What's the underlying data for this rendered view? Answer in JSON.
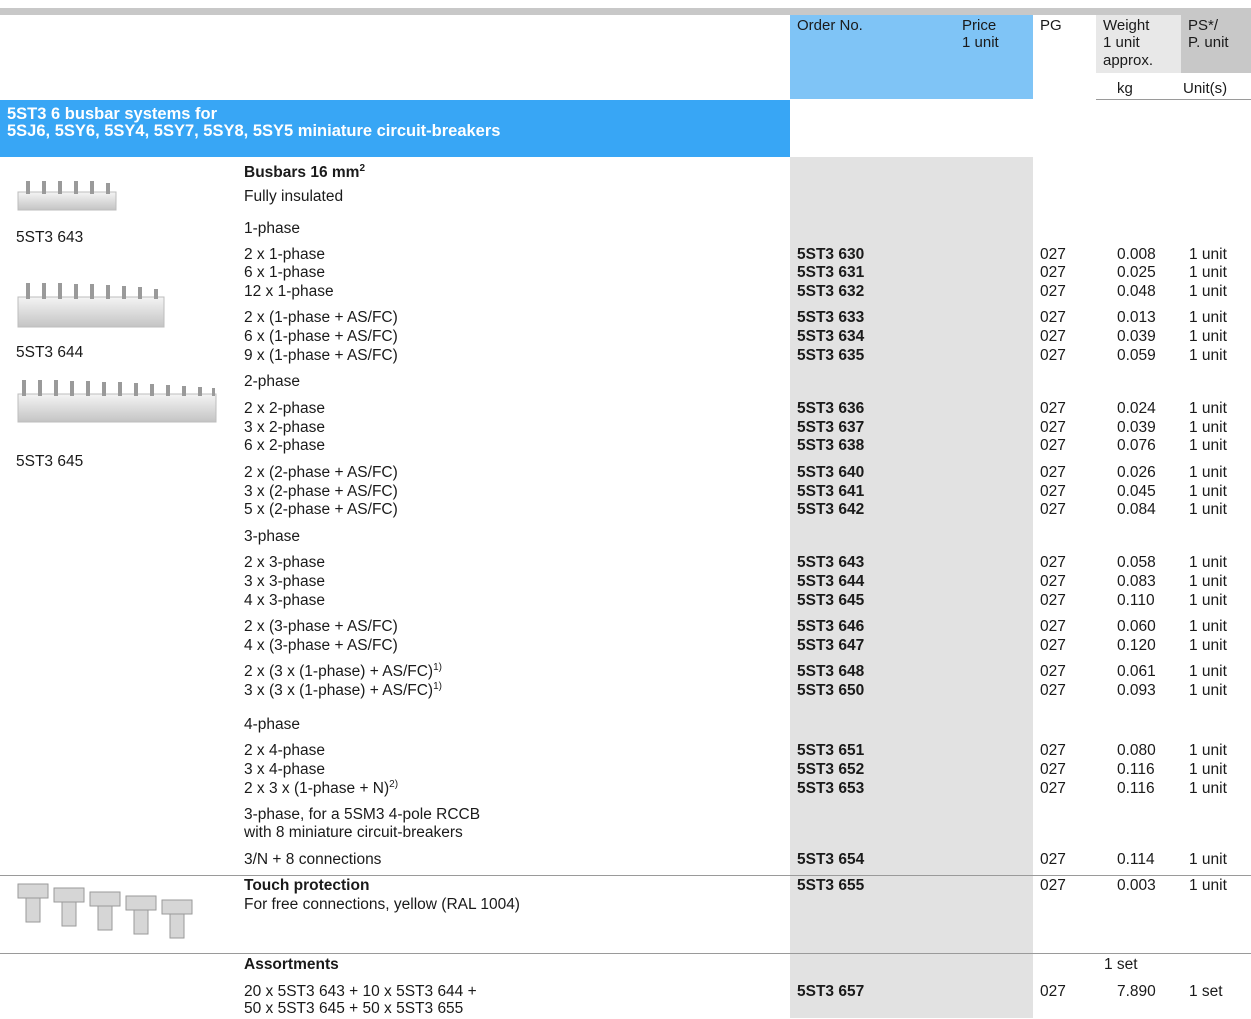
{
  "header": {
    "order_no": "Order No.",
    "price": "Price",
    "price_unit": "1 unit",
    "pg": "PG",
    "weight": "Weight",
    "weight_unit": "1 unit",
    "weight_approx": "approx.",
    "weight_kg": "kg",
    "ps": "PS*/",
    "ps_unit": "P. unit",
    "ps_units": "Unit(s)"
  },
  "section": {
    "title_line1": "5ST3 6 busbar systems for",
    "title_line2": "5SJ6, 5SY6, 5SY4, 5SY7, 5SY8, 5SY5 miniature circuit-breakers"
  },
  "busbars": {
    "title": "Busbars 16 mm",
    "title_sup": "2",
    "subtitle": "Fully insulated"
  },
  "image_labels": [
    "5ST3 643",
    "5ST3 644",
    "5ST3 645"
  ],
  "subheads": {
    "phase1": "1-phase",
    "phase2": "2-phase",
    "phase3": "3-phase",
    "phase4": "4-phase",
    "rccb_line1": "3-phase, for a 5SM3 4-pole RCCB",
    "rccb_line2": "with 8 miniature circuit-breakers"
  },
  "rows": [
    {
      "desc": "2 x 1-phase",
      "sup": "",
      "order": "5ST3 630",
      "pg": "027",
      "weight": "0.008",
      "ps": "1 unit"
    },
    {
      "desc": "6 x 1-phase",
      "sup": "",
      "order": "5ST3 631",
      "pg": "027",
      "weight": "0.025",
      "ps": "1 unit"
    },
    {
      "desc": "12 x 1-phase",
      "sup": "",
      "order": "5ST3 632",
      "pg": "027",
      "weight": "0.048",
      "ps": "1 unit"
    },
    {
      "desc": "2 x (1-phase + AS/FC)",
      "sup": "",
      "order": "5ST3 633",
      "pg": "027",
      "weight": "0.013",
      "ps": "1 unit"
    },
    {
      "desc": "6 x (1-phase + AS/FC)",
      "sup": "",
      "order": "5ST3 634",
      "pg": "027",
      "weight": "0.039",
      "ps": "1 unit"
    },
    {
      "desc": "9 x (1-phase + AS/FC)",
      "sup": "",
      "order": "5ST3 635",
      "pg": "027",
      "weight": "0.059",
      "ps": "1 unit"
    },
    {
      "desc": "2 x 2-phase",
      "sup": "",
      "order": "5ST3 636",
      "pg": "027",
      "weight": "0.024",
      "ps": "1 unit"
    },
    {
      "desc": "3 x 2-phase",
      "sup": "",
      "order": "5ST3 637",
      "pg": "027",
      "weight": "0.039",
      "ps": "1 unit"
    },
    {
      "desc": "6 x 2-phase",
      "sup": "",
      "order": "5ST3 638",
      "pg": "027",
      "weight": "0.076",
      "ps": "1 unit"
    },
    {
      "desc": "2 x (2-phase + AS/FC)",
      "sup": "",
      "order": "5ST3 640",
      "pg": "027",
      "weight": "0.026",
      "ps": "1 unit"
    },
    {
      "desc": "3 x (2-phase + AS/FC)",
      "sup": "",
      "order": "5ST3 641",
      "pg": "027",
      "weight": "0.045",
      "ps": "1 unit"
    },
    {
      "desc": "5 x (2-phase + AS/FC)",
      "sup": "",
      "order": "5ST3 642",
      "pg": "027",
      "weight": "0.084",
      "ps": "1 unit"
    },
    {
      "desc": "2 x 3-phase",
      "sup": "",
      "order": "5ST3 643",
      "pg": "027",
      "weight": "0.058",
      "ps": "1 unit"
    },
    {
      "desc": "3 x 3-phase",
      "sup": "",
      "order": "5ST3 644",
      "pg": "027",
      "weight": "0.083",
      "ps": "1 unit"
    },
    {
      "desc": "4 x 3-phase",
      "sup": "",
      "order": "5ST3 645",
      "pg": "027",
      "weight": "0.110",
      "ps": "1 unit"
    },
    {
      "desc": "2 x (3-phase + AS/FC)",
      "sup": "",
      "order": "5ST3 646",
      "pg": "027",
      "weight": "0.060",
      "ps": "1 unit"
    },
    {
      "desc": "4 x (3-phase + AS/FC)",
      "sup": "",
      "order": "5ST3 647",
      "pg": "027",
      "weight": "0.120",
      "ps": "1 unit"
    },
    {
      "desc": "2 x (3 x (1-phase) + AS/FC)",
      "sup": "1)",
      "order": "5ST3 648",
      "pg": "027",
      "weight": "0.061",
      "ps": "1 unit"
    },
    {
      "desc": "3 x (3 x (1-phase) + AS/FC)",
      "sup": "1)",
      "order": "5ST3 650",
      "pg": "027",
      "weight": "0.093",
      "ps": "1 unit"
    },
    {
      "desc": "2 x 4-phase",
      "sup": "",
      "order": "5ST3 651",
      "pg": "027",
      "weight": "0.080",
      "ps": "1 unit"
    },
    {
      "desc": "3 x 4-phase",
      "sup": "",
      "order": "5ST3 652",
      "pg": "027",
      "weight": "0.116",
      "ps": "1 unit"
    },
    {
      "desc": "2 x 3 x (1-phase + N)",
      "sup": "2)",
      "order": "5ST3 653",
      "pg": "027",
      "weight": "0.116",
      "ps": "1 unit"
    },
    {
      "desc": "3/N + 8 connections",
      "sup": "",
      "order": "5ST3 654",
      "pg": "027",
      "weight": "0.114",
      "ps": "1 unit"
    }
  ],
  "touch": {
    "title": "Touch protection",
    "desc": "For free connections, yellow (RAL 1004)",
    "order": "5ST3 655",
    "pg": "027",
    "weight": "0.003",
    "ps": "1 unit"
  },
  "assort": {
    "title": "Assortments",
    "weight_note": "1 set",
    "line1": "20 x 5ST3 643 + 10 x 5ST3 644 +",
    "line2": "50 x 5ST3 645 + 50 x 5ST3 655",
    "order": "5ST3 657",
    "pg": "027",
    "weight": "7.890",
    "ps": "1 set"
  }
}
